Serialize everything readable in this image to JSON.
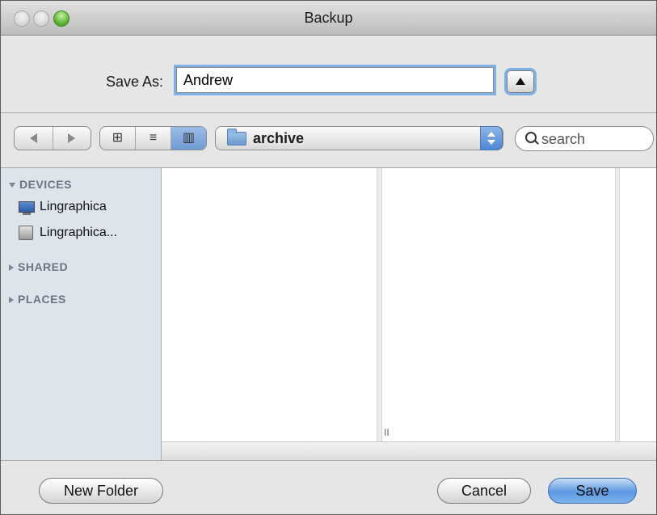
{
  "window": {
    "title": "Backup"
  },
  "save_as": {
    "label": "Save As:",
    "value": "Andrew"
  },
  "toolbar": {
    "path_label": "archive",
    "search_placeholder": "search"
  },
  "sidebar": {
    "sections": [
      {
        "label": "DEVICES",
        "expanded": true,
        "items": [
          {
            "label": "Lingraphica",
            "icon": "display-icon"
          },
          {
            "label": "Lingraphica...",
            "icon": "drive-icon"
          }
        ]
      },
      {
        "label": "SHARED",
        "expanded": false
      },
      {
        "label": "PLACES",
        "expanded": false
      }
    ]
  },
  "browser": {
    "resize_glyph": "II"
  },
  "buttons": {
    "new_folder": "New Folder",
    "cancel": "Cancel",
    "save": "Save"
  },
  "colors": {
    "accent": "#5c98e0",
    "sidebar_bg": "#dde4ec"
  }
}
